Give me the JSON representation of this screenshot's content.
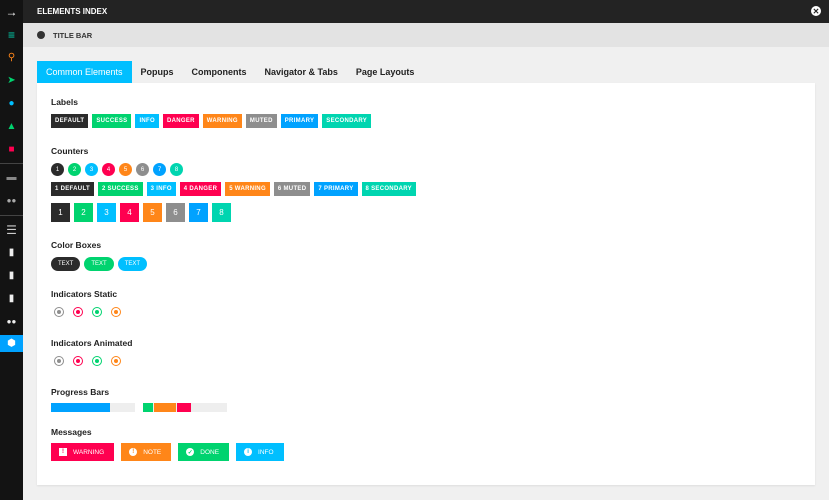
{
  "header": {
    "title": "ELEMENTS INDEX",
    "title_bar": "TITLE BAR"
  },
  "tabs": [
    "Common Elements",
    "Popups",
    "Components",
    "Navigator & Tabs",
    "Page Layouts"
  ],
  "colors": {
    "default": "#2b2b2b",
    "success": "#00d36f",
    "info": "#00bfff",
    "danger": "#ff0050",
    "warning": "#ff8619",
    "muted": "#8e8e8e",
    "primary": "#00a2ff",
    "secondary": "#00d5b0"
  },
  "sections": {
    "labels": "Labels",
    "counters": "Counters",
    "color_boxes": "Color Boxes",
    "ind_static": "Indicators Static",
    "ind_anim": "Indicators Animated",
    "progress": "Progress Bars",
    "messages": "Messages"
  },
  "labels": [
    "DEFAULT",
    "SUCCESS",
    "INFO",
    "DANGER",
    "WARNING",
    "MUTED",
    "PRIMARY",
    "SECONDARY"
  ],
  "counters": [
    "1",
    "2",
    "3",
    "4",
    "5",
    "6",
    "7",
    "8"
  ],
  "counter_labels": [
    "1 DEFAULT",
    "2 SUCCESS",
    "3 INFO",
    "4 DANGER",
    "5 WARNING",
    "6 MUTED",
    "7 PRIMARY",
    "8 SECONDARY"
  ],
  "color_boxes": [
    "TEXT",
    "TEXT",
    "TEXT"
  ],
  "progress": {
    "single_percent": 70,
    "stacked_percent": [
      12,
      26,
      17
    ]
  },
  "messages": [
    "WARNING",
    "NOTE",
    "DONE",
    "INFO"
  ]
}
